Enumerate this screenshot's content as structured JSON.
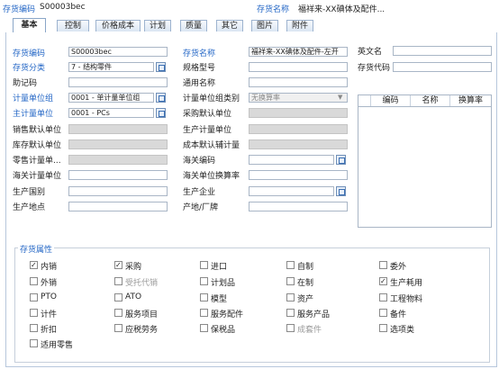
{
  "header": {
    "code_label": "存货编码",
    "code_value": "S00003bec",
    "name_label": "存货名称",
    "name_value": "福祥来-XX碘体及配件..."
  },
  "tabs": [
    "基本",
    "控制",
    "价格成本",
    "计划",
    "质量",
    "其它",
    "图片",
    "附件"
  ],
  "form": {
    "code_label": "存货编码",
    "code_value": "S00003bec",
    "category_label": "存货分类",
    "category_value": "7 - 结构零件",
    "mnemonic_label": "助记码",
    "unit_group_label": "计量单位组",
    "unit_group_value": "0001 - 单计量单位组",
    "main_unit_label": "主计量单位",
    "main_unit_value": "0001 - PCs",
    "sales_unit_label": "销售默认单位",
    "stock_unit_label": "库存默认单位",
    "retail_unit_label": "零售计量单...",
    "customs_unit_label": "海关计量单位",
    "origin_country_label": "生产国别",
    "origin_place_label": "生产地点",
    "name_label": "存货名称",
    "name_value": "福祥来-XX碘体及配件-左开",
    "spec_label": "规格型号",
    "common_name_label": "通用名称",
    "unit_group_type_label": "计量单位组类别",
    "unit_group_type_value": "无换算率",
    "purchase_unit_label": "采购默认单位",
    "production_unit_label": "生产计量单位",
    "cost_unit_label": "成本默认辅计量",
    "customs_code_label": "海关编码",
    "customs_rate_label": "海关单位换算率",
    "manufacturer_label": "生产企业",
    "producer_label": "产地/厂牌",
    "english_name_label": "英文名",
    "inventory_code_label": "存货代码"
  },
  "unit_table": {
    "columns": [
      "编码",
      "名称",
      "换算率"
    ]
  },
  "attributes": {
    "title": "存货属性",
    "items": [
      {
        "label": "内销",
        "checked": true,
        "disabled": false
      },
      {
        "label": "采购",
        "checked": true,
        "disabled": false
      },
      {
        "label": "进口",
        "checked": false,
        "disabled": false
      },
      {
        "label": "自制",
        "checked": false,
        "disabled": false
      },
      {
        "label": "委外",
        "checked": false,
        "disabled": false
      },
      {
        "label": "外销",
        "checked": false,
        "disabled": false
      },
      {
        "label": "受托代销",
        "checked": false,
        "disabled": true
      },
      {
        "label": "计划品",
        "checked": false,
        "disabled": false
      },
      {
        "label": "在制",
        "checked": false,
        "disabled": false
      },
      {
        "label": "生产耗用",
        "checked": true,
        "disabled": false
      },
      {
        "label": "PTO",
        "checked": false,
        "disabled": false
      },
      {
        "label": "ATO",
        "checked": false,
        "disabled": false
      },
      {
        "label": "模型",
        "checked": false,
        "disabled": false
      },
      {
        "label": "资产",
        "checked": false,
        "disabled": false
      },
      {
        "label": "工程物料",
        "checked": false,
        "disabled": false
      },
      {
        "label": "计件",
        "checked": false,
        "disabled": false
      },
      {
        "label": "服务项目",
        "checked": false,
        "disabled": false
      },
      {
        "label": "服务配件",
        "checked": false,
        "disabled": false
      },
      {
        "label": "服务产品",
        "checked": false,
        "disabled": false
      },
      {
        "label": "备件",
        "checked": false,
        "disabled": false
      },
      {
        "label": "折扣",
        "checked": false,
        "disabled": false
      },
      {
        "label": "应税劳务",
        "checked": false,
        "disabled": false
      },
      {
        "label": "保税品",
        "checked": false,
        "disabled": false
      },
      {
        "label": "成套件",
        "checked": false,
        "disabled": true
      },
      {
        "label": "选项类",
        "checked": false,
        "disabled": false
      },
      {
        "label": "适用零售",
        "checked": false,
        "disabled": false
      }
    ]
  }
}
